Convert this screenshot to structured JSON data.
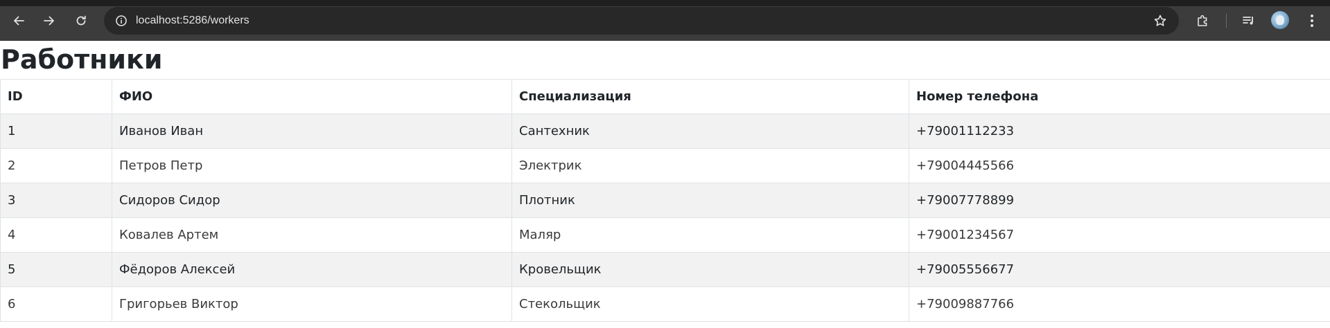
{
  "browser": {
    "url": "localhost:5286/workers",
    "icons": {
      "back": "arrow-left-icon",
      "forward": "arrow-right-icon",
      "reload": "reload-icon",
      "site_info": "info-icon",
      "bookmark": "star-icon",
      "extensions": "puzzle-icon",
      "media": "media-queue-icon",
      "profile": "avatar",
      "menu": "kebab-menu-icon"
    }
  },
  "page": {
    "title": "Работники"
  },
  "table": {
    "headers": [
      "ID",
      "ФИО",
      "Специализация",
      "Номер телефона"
    ],
    "rows": [
      {
        "id": "1",
        "name": "Иванов Иван",
        "specialization": "Сантехник",
        "phone": "+79001112233"
      },
      {
        "id": "2",
        "name": "Петров Петр",
        "specialization": "Электрик",
        "phone": "+79004445566"
      },
      {
        "id": "3",
        "name": "Сидоров Сидор",
        "specialization": "Плотник",
        "phone": "+79007778899"
      },
      {
        "id": "4",
        "name": "Ковалев Артем",
        "specialization": "Маляр",
        "phone": "+79001234567"
      },
      {
        "id": "5",
        "name": "Фёдоров Алексей",
        "specialization": "Кровельщик",
        "phone": "+79005556677"
      },
      {
        "id": "6",
        "name": "Григорьев Виктор",
        "specialization": "Стекольщик",
        "phone": "+79009887766"
      }
    ]
  },
  "colors": {
    "toolbar": "#3c3c3c",
    "omnibox": "#282828",
    "row_stripe": "#f2f2f2",
    "border": "#dee2e6",
    "text": "#212529"
  }
}
